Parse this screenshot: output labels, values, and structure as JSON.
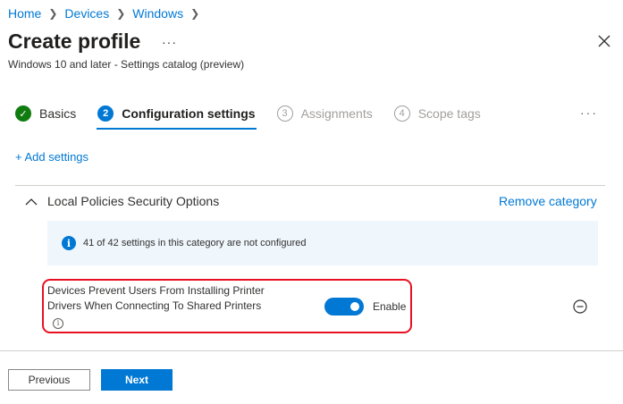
{
  "breadcrumb": [
    "Home",
    "Devices",
    "Windows"
  ],
  "header": {
    "title": "Create profile",
    "subtitle": "Windows 10 and later - Settings catalog (preview)",
    "more_label": "···"
  },
  "steps": [
    {
      "num": "✓",
      "label": "Basics",
      "state": "done"
    },
    {
      "num": "2",
      "label": "Configuration settings",
      "state": "active"
    },
    {
      "num": "3",
      "label": "Assignments",
      "state": "pending"
    },
    {
      "num": "4",
      "label": "Scope tags",
      "state": "pending"
    }
  ],
  "steps_more_label": "···",
  "add_settings_label": "+ Add settings",
  "category": {
    "title": "Local Policies Security Options",
    "remove_label": "Remove category",
    "info_text": "41 of 42 settings in this category are not configured"
  },
  "setting": {
    "label": "Devices Prevent Users From Installing Printer Drivers When Connecting To Shared Printers",
    "value": "Enable",
    "enabled": true
  },
  "footer": {
    "previous_label": "Previous",
    "next_label": "Next"
  },
  "colors": {
    "accent": "#0078d4",
    "success": "#107c10",
    "highlight": "#e81123"
  }
}
